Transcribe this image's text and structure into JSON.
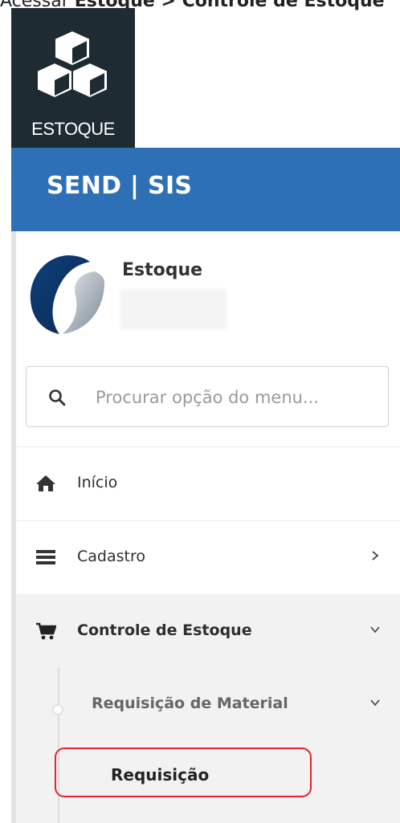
{
  "caption": {
    "prefix": "Acessar ",
    "bold": "Estoque",
    "suffix": " > Controle de Estoque"
  },
  "app_tile": {
    "label": "ESTOQUE",
    "icon": "cubes-icon"
  },
  "header": {
    "brand": "SEND | SIS",
    "color": "#2e70b5"
  },
  "profile": {
    "name": "Estoque"
  },
  "search": {
    "placeholder": "Procurar opção do menu..."
  },
  "menu": {
    "inicio": {
      "label": "Início",
      "icon": "home-icon"
    },
    "cadastro": {
      "label": "Cadastro",
      "icon": "list-icon"
    },
    "controle": {
      "label": "Controle de Estoque",
      "icon": "cart-icon"
    },
    "requisicao_material": {
      "label": "Requisição de Material"
    },
    "requisicao": {
      "label": "Requisição"
    }
  },
  "colors": {
    "highlight": "#e0252f",
    "tile_bg": "#1f2b33"
  }
}
